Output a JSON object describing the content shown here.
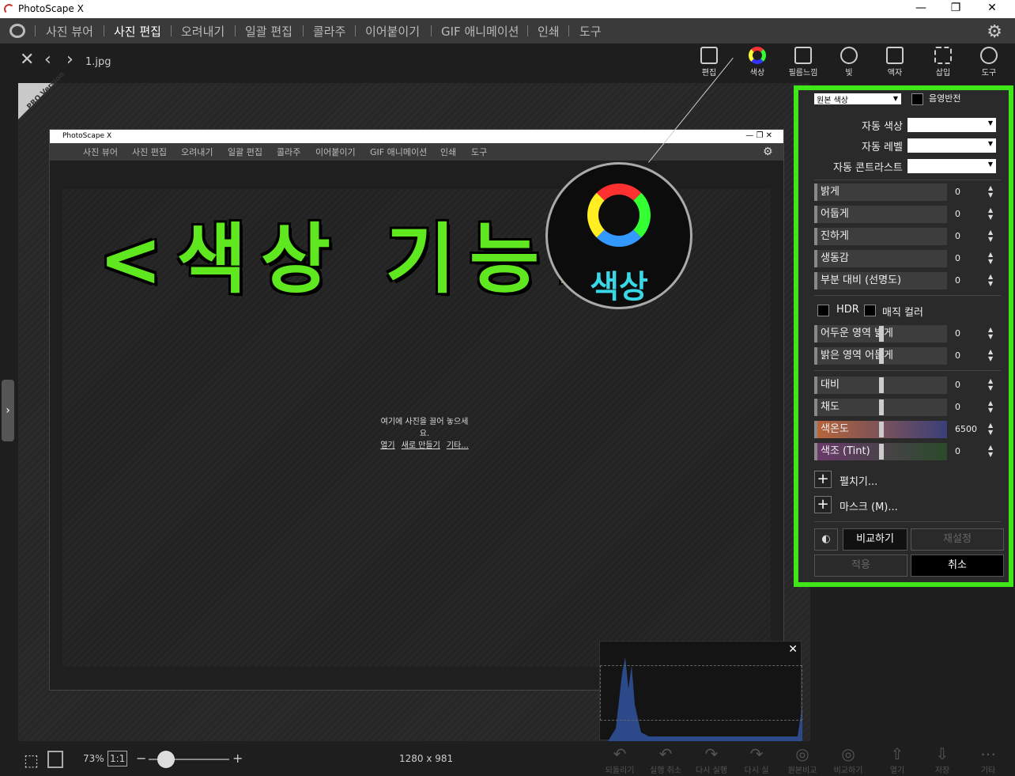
{
  "window": {
    "title": "PhotoScape X",
    "minimize": "—",
    "restore": "❐",
    "close": "✕"
  },
  "menu": {
    "items": [
      "사진 뷰어",
      "사진 편집",
      "오려내기",
      "일괄 편집",
      "콜라주",
      "이어붙이기",
      "GIF 애니메이션",
      "인쇄",
      "도구"
    ],
    "active_index": 1
  },
  "toolbar": {
    "filename": "1.jpg",
    "tools": [
      "편집",
      "색상",
      "필름느낌",
      "빛",
      "액자",
      "삽입",
      "도구"
    ]
  },
  "pro_badge": "PRO Version",
  "overlay": {
    "heading": "<색상 기능>",
    "zoom_label": "색상"
  },
  "inner": {
    "title": "PhotoScape X",
    "menu": [
      "사진 뷰어",
      "사진 편집",
      "오려내기",
      "일괄 편집",
      "콜라주",
      "이어붙이기",
      "GIF 애니메이션",
      "인쇄",
      "도구"
    ],
    "drop_text": "여기에 사진을 끌어 놓으세요.",
    "links": [
      "열기",
      "새로 만들기",
      "기타..."
    ]
  },
  "panel": {
    "top_partial": {
      "preset": "원본 색상",
      "invert": "음영반전"
    },
    "auto": [
      {
        "label": "자동 색상"
      },
      {
        "label": "자동 레벨"
      },
      {
        "label": "자동 콘트라스트"
      }
    ],
    "sliders1": [
      {
        "label": "밝게",
        "value": "0"
      },
      {
        "label": "어둡게",
        "value": "0"
      },
      {
        "label": "진하게",
        "value": "0"
      },
      {
        "label": "생동감",
        "value": "0"
      },
      {
        "label": "부분 대비 (선명도)",
        "value": "0"
      }
    ],
    "hdr": "HDR",
    "magic": "매직 컬러",
    "sliders2": [
      {
        "label": "어두운 영역 밝게",
        "value": "0"
      },
      {
        "label": "밝은 영역 어둡게",
        "value": "0"
      }
    ],
    "sliders3": [
      {
        "label": "대비",
        "value": "0"
      },
      {
        "label": "채도",
        "value": "0"
      },
      {
        "label": "색온도",
        "value": "6500"
      },
      {
        "label": "색조 (Tint)",
        "value": "0"
      }
    ],
    "expand": "펼치기...",
    "mask": "마스크 (M)...",
    "compare": "비교하기",
    "reset": "재설정",
    "apply": "적용",
    "cancel": "취소"
  },
  "bottom": {
    "zoom": "73%",
    "ratio": "1:1",
    "size": "1280 x 981",
    "minus": "−",
    "plus": "+"
  },
  "bottom_tools": [
    "되돌리기",
    "실행 취소",
    "다시 실행",
    "다시 실",
    "원본비교",
    "비교하기",
    "열기",
    "저장",
    "기타"
  ],
  "histogram": {
    "close": "✕",
    "tools": [
      "열기",
      "기타"
    ]
  }
}
